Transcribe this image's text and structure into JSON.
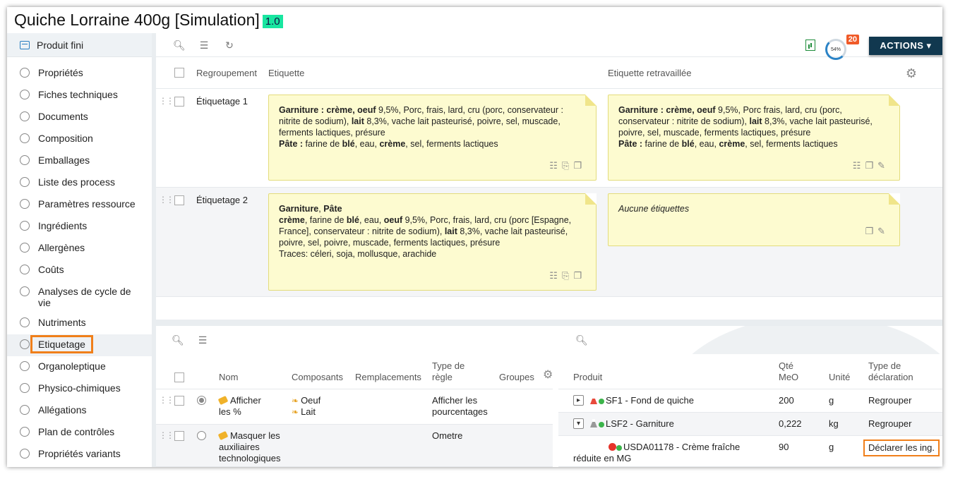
{
  "title": {
    "text": "Quiche Lorraine 400g [Simulation]",
    "version": "1.0"
  },
  "sidebar": {
    "header": "Produit fini",
    "items": [
      {
        "label": "Propriétés"
      },
      {
        "label": "Fiches techniques"
      },
      {
        "label": "Documents"
      },
      {
        "label": "Composition"
      },
      {
        "label": "Emballages"
      },
      {
        "label": "Liste des process"
      },
      {
        "label": "Paramètres ressource"
      },
      {
        "label": "Ingrédients"
      },
      {
        "label": "Allergènes"
      },
      {
        "label": "Coûts"
      },
      {
        "label": "Analyses de cycle de vie"
      },
      {
        "label": "Nutriments"
      },
      {
        "label": "Etiquetage",
        "active": true
      },
      {
        "label": "Organoleptique"
      },
      {
        "label": "Physico-chimiques"
      },
      {
        "label": "Allégations"
      },
      {
        "label": "Plan de contrôles"
      },
      {
        "label": "Propriétés variants"
      }
    ]
  },
  "toolbar": {
    "progress_text": "54%",
    "notification_count": "20",
    "actions_label": "ACTIONS ▾"
  },
  "labels_grid": {
    "columns": {
      "group": "Regroupement",
      "label": "Etiquette",
      "reworked": "Etiquette retravaillée"
    },
    "rows": [
      {
        "group": "Étiquetage 1",
        "label": {
          "garniture_title": "Garniture : ",
          "creme": "crème",
          "sep1": ", ",
          "oeuf": "oeuf",
          "t1": " 9,5%, Porc, frais, lard, cru (porc, conservateur : nitrite de sodium), ",
          "lait": "lait",
          "t2": " 8,3%, vache lait pasteurisé, poivre, sel, muscade, ferments lactiques, présure",
          "pate_title": "Pâte : ",
          "t3": "farine de ",
          "ble": "blé",
          "t4": ", eau, ",
          "creme2": "crème",
          "t5": ", sel, ferments lactiques"
        },
        "reworked": {
          "garniture_title": "Garniture : ",
          "creme": "crème",
          "sep1": ", ",
          "oeuf": "oeuf",
          "t1": " 9,5%, Porc frais, lard, cru (porc, conservateur : nitrite de sodium), ",
          "lait": "lait",
          "t2": " 8,3%, vache lait pasteurisé, poivre, sel, muscade, ferments lactiques, présure",
          "pate_title": "Pâte : ",
          "t3": "farine de ",
          "ble": "blé",
          "t4": ", eau, ",
          "creme2": "crème",
          "t5": ", sel, ferments lactiques"
        }
      },
      {
        "group": "Étiquetage 2",
        "label": {
          "head1": "Garniture",
          "head_sep": ", ",
          "head2": "Pâte",
          "creme": "crème",
          "t1": ", farine de ",
          "ble": "blé",
          "t2": ", eau, ",
          "oeuf": "oeuf",
          "t3": " 9,5%, Porc, frais, lard, cru (porc [Espagne, France], conservateur : nitrite de sodium), ",
          "lait": "lait",
          "t4": " 8,3%, vache lait pasteurisé, poivre, sel, poivre, muscade, ferments lactiques, présure",
          "traces": "Traces: céleri, soja, mollusque, arachide"
        },
        "reworked": {
          "empty": "Aucune étiquettes"
        }
      }
    ]
  },
  "rules_grid": {
    "columns": {
      "name": "Nom",
      "components": "Composants",
      "replacements": "Remplacements",
      "rule_type": "Type de règle",
      "groups": "Groupes"
    },
    "rows": [
      {
        "name": "Afficher les %",
        "components": [
          "Oeuf",
          "Lait"
        ],
        "rule_type": "Afficher les pourcentages"
      },
      {
        "name": "Masquer les auxiliaires technologiques",
        "components": [],
        "rule_type": "Ometre"
      }
    ]
  },
  "products_grid": {
    "columns": {
      "product": "Produit",
      "qty": "Qté MeO",
      "unit": "Unité",
      "decl_type": "Type de déclaration"
    },
    "rows": [
      {
        "name": "SF1 - Fond de quiche",
        "qty": "200",
        "unit": "g",
        "decl": "Regrouper"
      },
      {
        "name": "LSF2 - Garniture",
        "qty": "0,222",
        "unit": "kg",
        "decl": "Regrouper"
      },
      {
        "name": "USDA01178 - Crème fraîche réduite en MG",
        "qty": "90",
        "unit": "g",
        "decl": "Déclarer les ing."
      }
    ]
  },
  "colors": {
    "accent_orange": "#f07f1a",
    "actions_bg": "#11384f",
    "version_badge": "#18e6a0",
    "note_bg": "#fdfbd0"
  }
}
